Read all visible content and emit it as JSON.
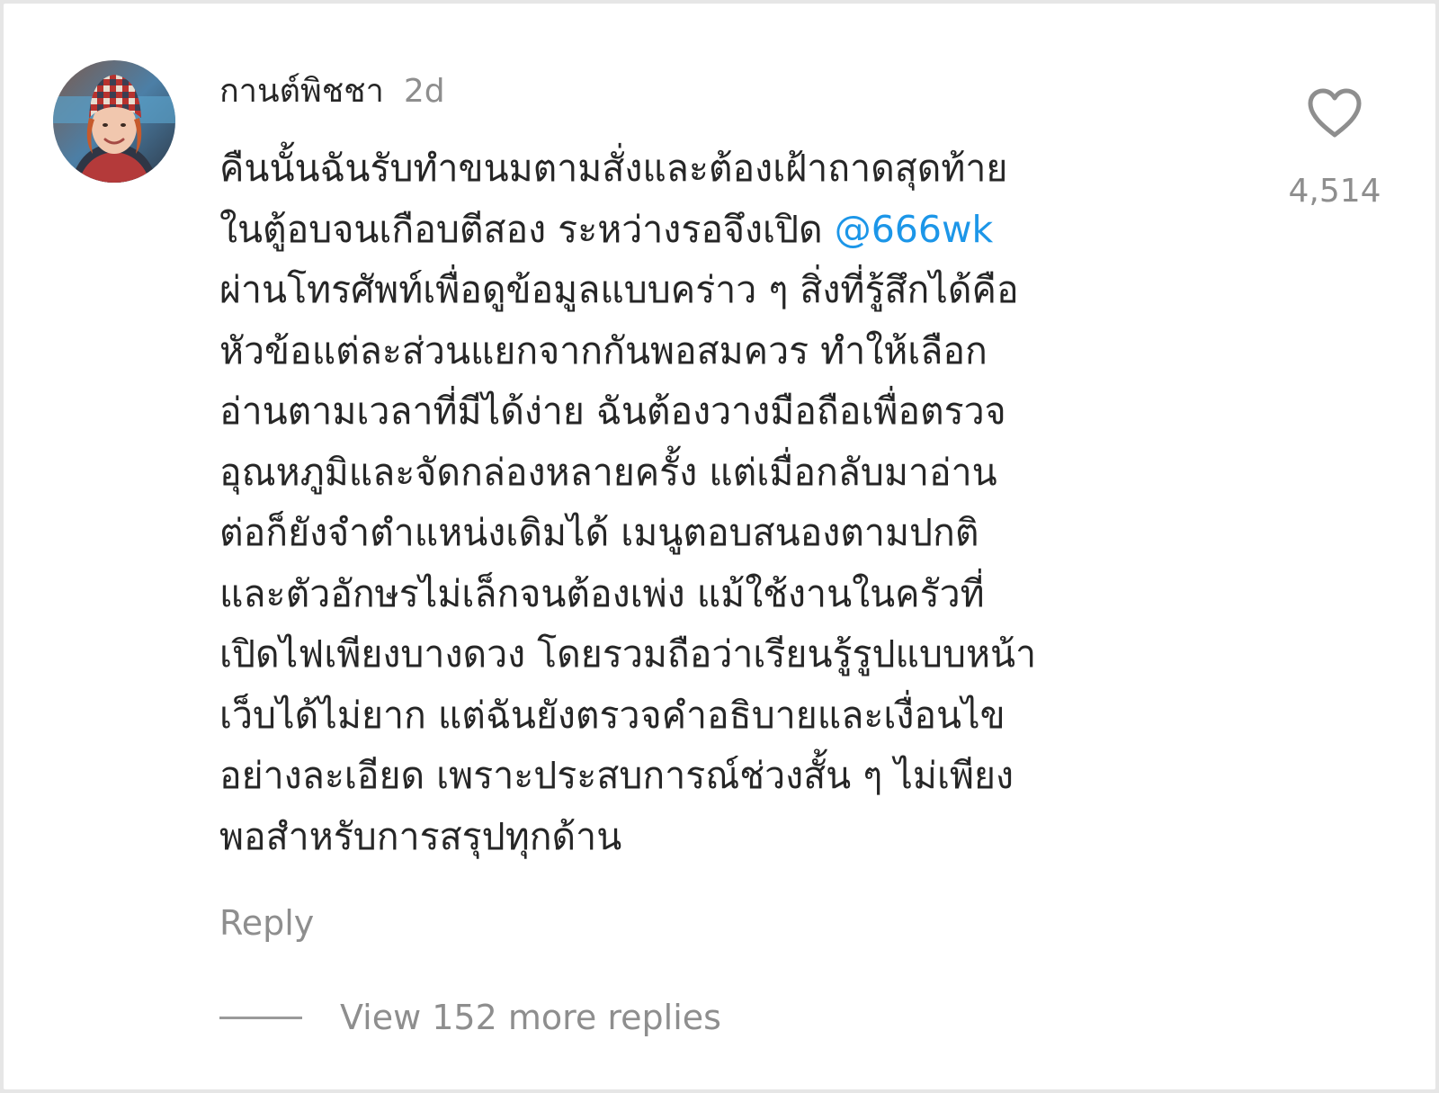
{
  "comment": {
    "username": "กานต์พิชชา",
    "timestamp": "2d",
    "text_lines": [
      "คืนนั้นฉันรับทำขนมตามสั่งและต้องเฝ้าถาดสุดท้าย",
      "ในตู้อบจนเกือบตีสอง ระหว่างรอจึงเปิด ",
      "ผ่านโทรศัพท์เพื่อดูข้อมูลแบบคร่าว ๆ สิ่งที่รู้สึกได้คือ",
      "หัวข้อแต่ละส่วนแยกจากกันพอสมควร ทำให้เลือก",
      "อ่านตามเวลาที่มีได้ง่าย ฉันต้องวางมือถือเพื่อตรวจ",
      "อุณหภูมิและจัดกล่องหลายครั้ง แต่เมื่อกลับมาอ่าน",
      "ต่อก็ยังจำตำแหน่งเดิมได้ เมนูตอบสนองตามปกติ",
      "และตัวอักษรไม่เล็กจนต้องเพ่ง แม้ใช้งานในครัวที่",
      "เปิดไฟเพียงบางดวง โดยรวมถือว่าเรียนรู้รูปแบบหน้า",
      "เว็บได้ไม่ยาก แต่ฉันยังตรวจคำอธิบายและเงื่อนไข",
      "อย่างละเอียด เพราะประสบการณ์ช่วงสั้น ๆ ไม่เพียง",
      "พอสำหรับการสรุปทุกด้าน"
    ],
    "mention": "@666wk",
    "like_icon": "heart-outline-icon",
    "like_count": "4,514",
    "reply_label": "Reply",
    "view_replies_label": "View 152 more replies"
  },
  "colors": {
    "mention": "#1c96e8",
    "muted_text": "#8e8e8e",
    "primary_text": "#262626"
  }
}
